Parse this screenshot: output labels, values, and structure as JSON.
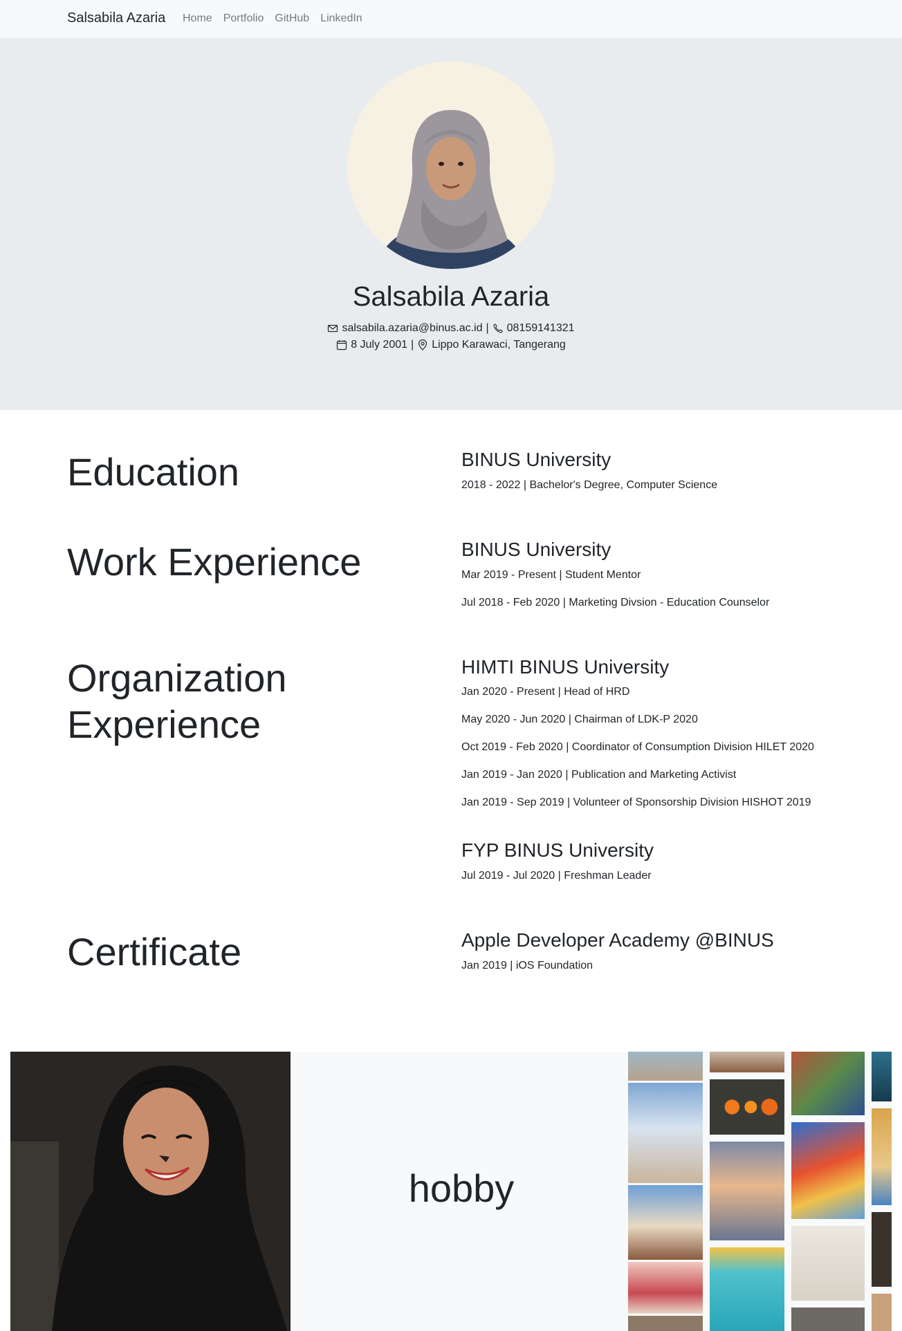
{
  "nav": {
    "brand": "Salsabila Azaria",
    "links": [
      "Home",
      "Portfolio",
      "GitHub",
      "LinkedIn"
    ]
  },
  "hero": {
    "name": "Salsabila Azaria",
    "email": "salsabila.azaria@binus.ac.id",
    "sep": "|",
    "phone": "08159141321",
    "dob": "8 July 2001",
    "location": "Lippo Karawaci, Tangerang"
  },
  "education": {
    "title": "Education",
    "org": "BINUS University",
    "items": [
      "2018 - 2022 | Bachelor's Degree, Computer Science"
    ]
  },
  "work": {
    "title": "Work Experience",
    "org": "BINUS University",
    "items": [
      "Mar 2019 - Present | Student Mentor",
      "Jul 2018 - Feb 2020 | Marketing Divsion - Education Counselor"
    ]
  },
  "organization": {
    "title_line1": "Organization",
    "title_line2": "Experience",
    "groups": [
      {
        "org": "HIMTI BINUS University",
        "items": [
          "Jan 2020 - Present | Head of HRD",
          "May 2020 - Jun 2020 | Chairman of LDK-P 2020",
          "Oct 2019 - Feb 2020 | Coordinator of Consumption Division HILET 2020",
          "Jan 2019 - Jan 2020 | Publication and Marketing Activist",
          "Jan 2019 - Sep 2019 | Volunteer of Sponsorship Division HISHOT 2019"
        ]
      },
      {
        "org": "FYP BINUS University",
        "items": [
          "Jul 2019 - Jul 2020 | Freshman Leader"
        ]
      }
    ]
  },
  "certificate": {
    "title": "Certificate",
    "org": "Apple Developer Academy @BINUS",
    "items": [
      "Jan 2019 | iOS Foundation"
    ]
  },
  "hobby": {
    "title": "hobby"
  },
  "colors": {
    "navbar_bg": "#f8f9fa",
    "hero_bg": "#e9ecef",
    "text": "#212529",
    "nav_link": "#77797b"
  }
}
